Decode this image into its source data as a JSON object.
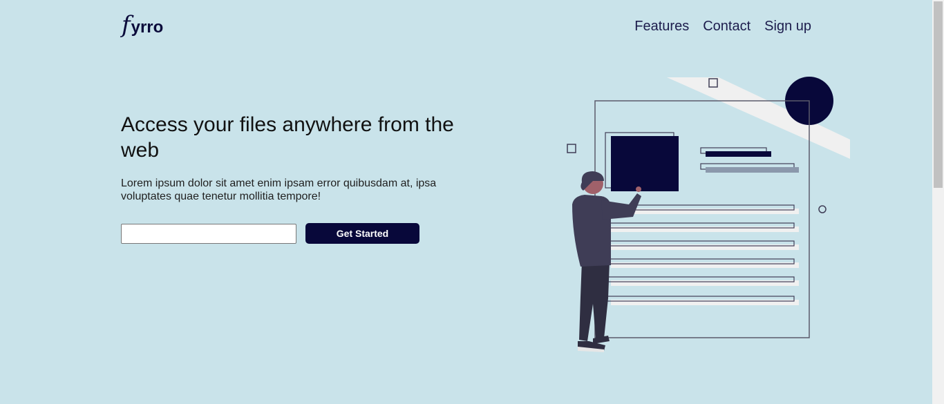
{
  "brand": {
    "logo_initial": "f",
    "logo_rest": "yrro"
  },
  "nav": {
    "items": [
      "Features",
      "Contact",
      "Sign up"
    ]
  },
  "hero": {
    "title": "Access your files anywhere from the web",
    "description": "Lorem ipsum dolor sit amet enim ipsam error quibusdam at, ipsa voluptates quae tenetur mollitia tempore!",
    "email_value": "",
    "email_placeholder": "",
    "cta_label": "Get Started"
  },
  "colors": {
    "background": "#c9e3ea",
    "brand_dark": "#08083a",
    "figure_hoodie": "#3f3d56",
    "figure_skin": "#a0616a"
  },
  "icons": [
    "document-person-illustration"
  ]
}
